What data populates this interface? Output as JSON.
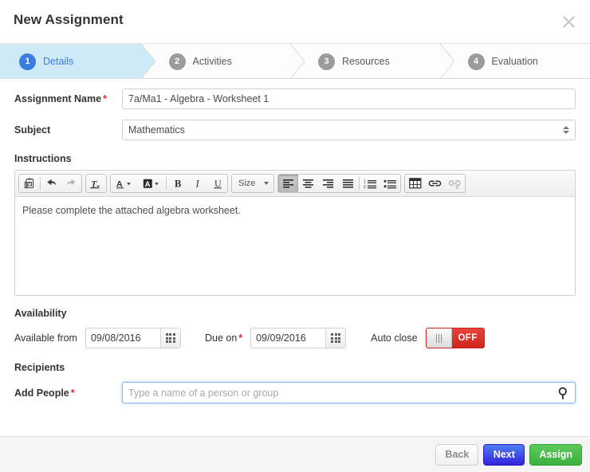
{
  "header": {
    "title": "New Assignment",
    "close_icon": "close-icon"
  },
  "steps": [
    {
      "number": "1",
      "label": "Details",
      "active": true
    },
    {
      "number": "2",
      "label": "Activities",
      "active": false
    },
    {
      "number": "3",
      "label": "Resources",
      "active": false
    },
    {
      "number": "4",
      "label": "Evaluation",
      "active": false
    }
  ],
  "form": {
    "assignment_name": {
      "label": "Assignment Name",
      "required_mark": "*",
      "value": "7a/Ma1 - Algebra - Worksheet 1",
      "placeholder": ""
    },
    "subject": {
      "label": "Subject",
      "value": "Mathematics"
    },
    "instructions": {
      "section_label": "Instructions",
      "body_text": "Please complete the attached algebra worksheet.",
      "toolbar": {
        "size_label": "Size",
        "buttons": [
          {
            "name": "paste-from-word-icon",
            "state": "normal"
          },
          {
            "name": "undo-icon",
            "state": "normal"
          },
          {
            "name": "redo-icon",
            "state": "disabled"
          },
          {
            "name": "remove-format-icon",
            "state": "normal"
          },
          {
            "name": "text-color-icon",
            "state": "normal"
          },
          {
            "name": "background-color-icon",
            "state": "normal"
          },
          {
            "name": "bold-icon",
            "state": "normal"
          },
          {
            "name": "italic-icon",
            "state": "normal"
          },
          {
            "name": "underline-icon",
            "state": "normal"
          },
          {
            "name": "align-left-icon",
            "state": "pressed"
          },
          {
            "name": "align-center-icon",
            "state": "normal"
          },
          {
            "name": "align-right-icon",
            "state": "normal"
          },
          {
            "name": "align-justify-icon",
            "state": "normal"
          },
          {
            "name": "numbered-list-icon",
            "state": "normal"
          },
          {
            "name": "bulleted-list-icon",
            "state": "normal"
          },
          {
            "name": "table-icon",
            "state": "normal"
          },
          {
            "name": "link-icon",
            "state": "normal"
          },
          {
            "name": "unlink-icon",
            "state": "disabled"
          }
        ],
        "labels": {
          "bold": "B",
          "italic": "I",
          "underline": "U",
          "text_color": "A",
          "background_color": "A",
          "remove_format": "T"
        }
      }
    },
    "availability": {
      "section_label": "Availability",
      "available_from": {
        "label": "Available from",
        "value": "09/08/2016",
        "calendar_icon": "calendar-icon"
      },
      "due_on": {
        "label": "Due on",
        "required_mark": "*",
        "value": "09/09/2016",
        "calendar_icon": "calendar-icon"
      },
      "auto_close": {
        "label": "Auto close",
        "state": "OFF"
      }
    },
    "recipients": {
      "section_label": "Recipients",
      "add_people": {
        "label": "Add People",
        "required_mark": "*",
        "value": "",
        "placeholder": "Type a name of a person or group",
        "search_icon": "search-icon"
      }
    }
  },
  "footer": {
    "back_label": "Back",
    "next_label": "Next",
    "assign_label": "Assign"
  },
  "colors": {
    "accent_blue": "#3b7ddd",
    "active_step_bg": "#ceeaf8",
    "required_red": "#e8302a",
    "toggle_off_red": "#d8352c",
    "next_blue": "#3220dd",
    "assign_green": "#3cb13c"
  }
}
